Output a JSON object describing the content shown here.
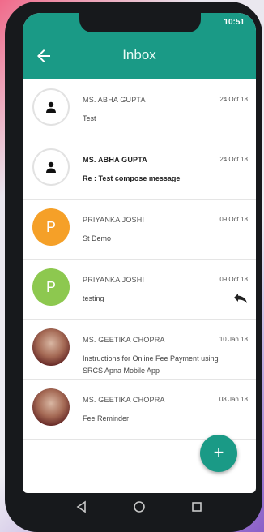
{
  "status": {
    "time": "10:51"
  },
  "header": {
    "title": "Inbox"
  },
  "messages": [
    {
      "sender": "MS. ABHA GUPTA",
      "date": "24 Oct 18",
      "subject": "Test",
      "avatar": "person-icon",
      "bold": false
    },
    {
      "sender": "MS. ABHA GUPTA",
      "date": "24 Oct 18",
      "subject": "Re : Test compose message",
      "avatar": "person-icon",
      "bold": true
    },
    {
      "sender": "PRIYANKA JOSHI",
      "date": "09 Oct 18",
      "subject": "St Demo",
      "avatar_letter": "P",
      "avatar_color": "#f5a028",
      "bold": false
    },
    {
      "sender": "PRIYANKA JOSHI",
      "date": "09 Oct 18",
      "subject": "testing",
      "avatar_letter": "P",
      "avatar_color": "#8dc84f",
      "bold": false,
      "icon": "reply-all-icon"
    },
    {
      "sender": "MS. GEETIKA CHOPRA",
      "date": "10 Jan 18",
      "subject": "Instructions for Online Fee Payment using SRCS Apna Mobile App",
      "avatar": "photo",
      "bold": false
    },
    {
      "sender": "MS. GEETIKA CHOPRA",
      "date": "08 Jan 18",
      "subject": "Fee Reminder",
      "avatar": "photo",
      "bold": false
    }
  ],
  "fab": {
    "label": "+",
    "icon": "plus-icon"
  },
  "colors": {
    "primary": "#1a9a86"
  }
}
